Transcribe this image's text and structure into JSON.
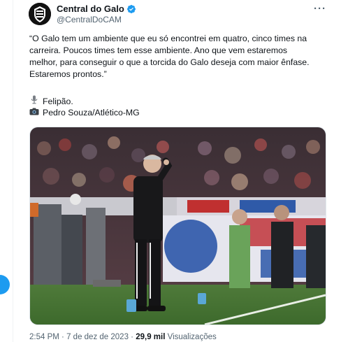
{
  "tweet": {
    "display_name": "Central do Galo",
    "handle": "@CentralDoCAM",
    "verified": true,
    "more_label": "···",
    "text_lines": [
      "“O Galo tem um ambiente que eu só encontrei em quatro, cinco times na",
      "carreira. Poucos times tem esse ambiente. Ano que vem estaremos",
      "melhor, para conseguir o que a torcida do Galo deseja com maior ênfase.",
      "Estaremos prontos.”"
    ],
    "speaker_icon": "microphone-icon",
    "speaker": "Felipão.",
    "photo_icon": "camera-icon",
    "photo_credit": "Pedro Souza/Atlético-MG",
    "time": "2:54 PM",
    "sep1": "·",
    "date": "7 de dez de 2023",
    "sep2": "·",
    "views_count": "29,9 mil",
    "views_label": "Visualizações"
  },
  "colors": {
    "accent": "#1d9bf0",
    "text": "#0f1419",
    "secondary": "#536471"
  }
}
